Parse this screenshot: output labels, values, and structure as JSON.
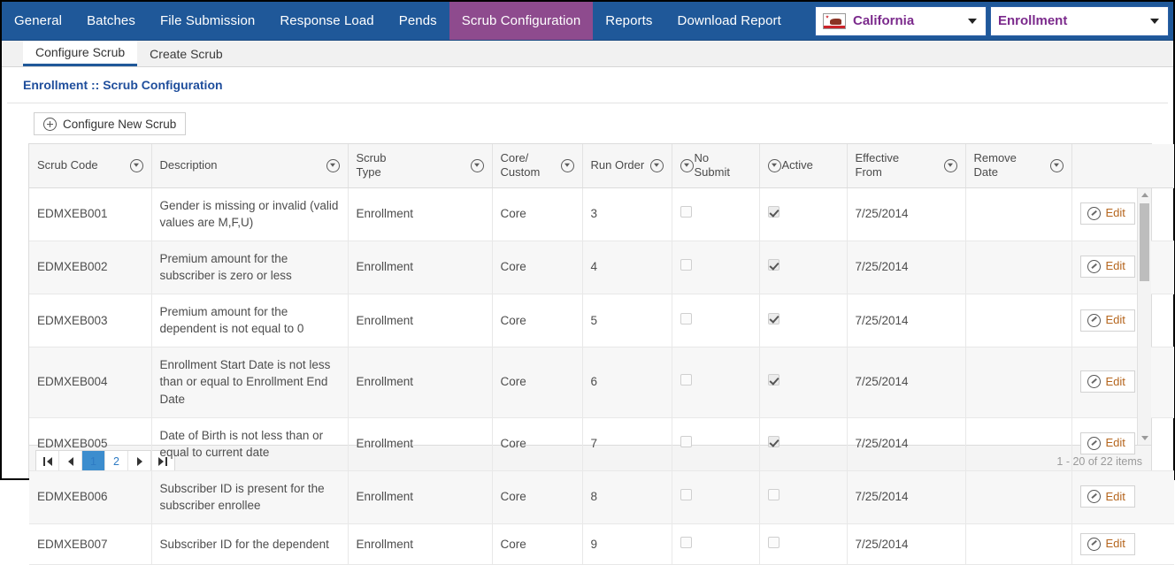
{
  "topnav": {
    "items": [
      {
        "label": "General",
        "active": false
      },
      {
        "label": "Batches",
        "active": false
      },
      {
        "label": "File Submission",
        "active": false
      },
      {
        "label": "Response Load",
        "active": false
      },
      {
        "label": "Pends",
        "active": false
      },
      {
        "label": "Scrub Configuration",
        "active": true
      },
      {
        "label": "Reports",
        "active": false
      },
      {
        "label": "Download Report",
        "active": false
      }
    ],
    "state_dropdown": {
      "label": "California",
      "icon": "california-flag-icon"
    },
    "module_dropdown": {
      "label": "Enrollment"
    },
    "colors": {
      "nav_bg": "#1F5899",
      "active_tab_bg": "#8E4B8E",
      "dropdown_text": "#7B2A8C"
    }
  },
  "subtabs": [
    {
      "label": "Configure Scrub",
      "active": true
    },
    {
      "label": "Create Scrub",
      "active": false
    }
  ],
  "page_title": "Enrollment :: Scrub Configuration",
  "toolbar": {
    "new_scrub_label": "Configure New Scrub",
    "new_scrub_icon": "plus-circle-icon"
  },
  "grid": {
    "columns": [
      {
        "label": "Scrub Code",
        "filter": true,
        "icon_first": false
      },
      {
        "label": "Description",
        "filter": true,
        "icon_first": false
      },
      {
        "label": "Scrub\nType",
        "filter": true,
        "icon_first": false
      },
      {
        "label": "Core/\nCustom",
        "filter": true,
        "icon_first": false
      },
      {
        "label": "Run Order",
        "filter": true,
        "icon_first": false
      },
      {
        "label": "No\nSubmit",
        "filter": true,
        "icon_first": true
      },
      {
        "label": "Active",
        "filter": true,
        "icon_first": true
      },
      {
        "label": "Effective\nFrom",
        "filter": true,
        "icon_first": false
      },
      {
        "label": "Remove\nDate",
        "filter": true,
        "icon_first": false
      },
      {
        "label": "",
        "filter": false,
        "icon_first": false
      }
    ],
    "rows": [
      {
        "scrub_code": "EDMXEB001",
        "description": "Gender is missing or invalid (valid values are M,F,U)",
        "scrub_type": "Enrollment",
        "core_custom": "Core",
        "run_order": "3",
        "no_submit": false,
        "active": true,
        "effective_from": "7/25/2014",
        "remove_date": "",
        "edit_label": "Edit"
      },
      {
        "scrub_code": "EDMXEB002",
        "description": "Premium amount for the subscriber is zero or less",
        "scrub_type": "Enrollment",
        "core_custom": "Core",
        "run_order": "4",
        "no_submit": false,
        "active": true,
        "effective_from": "7/25/2014",
        "remove_date": "",
        "edit_label": "Edit"
      },
      {
        "scrub_code": "EDMXEB003",
        "description": "Premium amount for the dependent is not equal to 0",
        "scrub_type": "Enrollment",
        "core_custom": "Core",
        "run_order": "5",
        "no_submit": false,
        "active": true,
        "effective_from": "7/25/2014",
        "remove_date": "",
        "edit_label": "Edit"
      },
      {
        "scrub_code": "EDMXEB004",
        "description": "Enrollment Start Date is not less than or equal to Enrollment End Date",
        "scrub_type": "Enrollment",
        "core_custom": "Core",
        "run_order": "6",
        "no_submit": false,
        "active": true,
        "effective_from": "7/25/2014",
        "remove_date": "",
        "edit_label": "Edit"
      },
      {
        "scrub_code": "EDMXEB005",
        "description": "Date of Birth is not less than or equal to current date",
        "scrub_type": "Enrollment",
        "core_custom": "Core",
        "run_order": "7",
        "no_submit": false,
        "active": true,
        "effective_from": "7/25/2014",
        "remove_date": "",
        "edit_label": "Edit"
      },
      {
        "scrub_code": "EDMXEB006",
        "description": "Subscriber ID is present for the subscriber enrollee",
        "scrub_type": "Enrollment",
        "core_custom": "Core",
        "run_order": "8",
        "no_submit": false,
        "active": false,
        "effective_from": "7/25/2014",
        "remove_date": "",
        "edit_label": "Edit"
      },
      {
        "scrub_code": "EDMXEB007",
        "description": "Subscriber ID for the dependent",
        "scrub_type": "Enrollment",
        "core_custom": "Core",
        "run_order": "9",
        "no_submit": false,
        "active": false,
        "effective_from": "7/25/2014",
        "remove_date": "",
        "edit_label": "Edit"
      }
    ]
  },
  "pager": {
    "first_label": "",
    "prev_label": "",
    "pages": [
      {
        "label": "1",
        "active": true
      },
      {
        "label": "2",
        "active": false
      }
    ],
    "next_label": "",
    "last_label": "",
    "info": "1 - 20 of 22 items"
  }
}
